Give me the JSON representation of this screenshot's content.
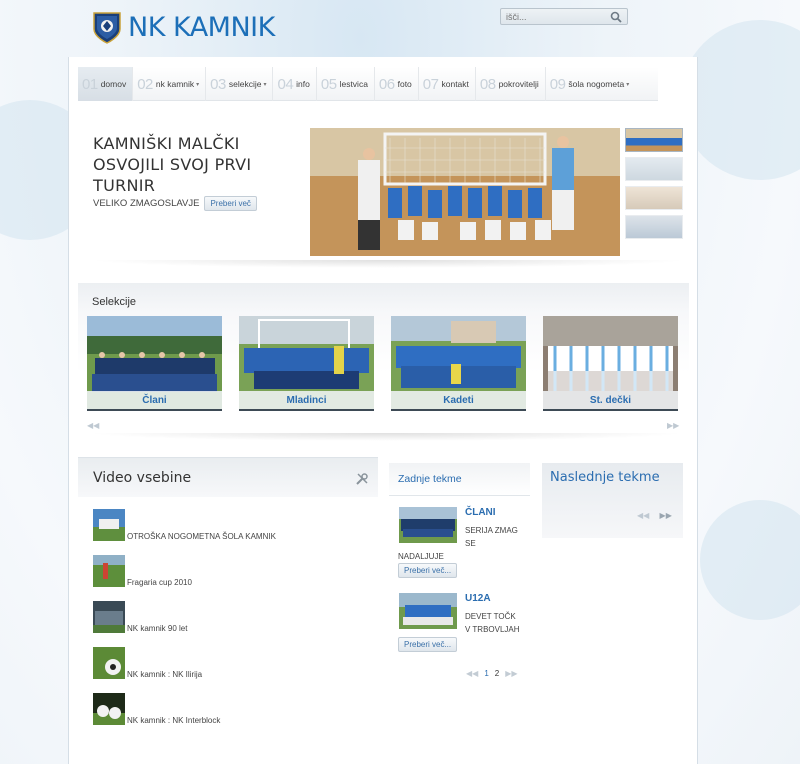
{
  "header": {
    "logo_text": "NK KAMNIK",
    "search_placeholder": "išči..."
  },
  "nav": {
    "items": [
      {
        "num": "01",
        "label": "domov",
        "caret": false
      },
      {
        "num": "02",
        "label": "nk kamnik",
        "caret": true
      },
      {
        "num": "03",
        "label": "selekcije",
        "caret": true
      },
      {
        "num": "04",
        "label": "info",
        "caret": false
      },
      {
        "num": "05",
        "label": "lestvica",
        "caret": false
      },
      {
        "num": "06",
        "label": "foto",
        "caret": false
      },
      {
        "num": "07",
        "label": "kontakt",
        "caret": false
      },
      {
        "num": "08",
        "label": "pokrovitelji",
        "caret": false
      },
      {
        "num": "09",
        "label": "šola nogometa",
        "caret": true
      }
    ],
    "caret_glyph": "▾"
  },
  "feature": {
    "title": "KAMNIŠKI MALČKI OSVOJILI SVOJ PRVI TURNIR",
    "subtitle": "VELIKO ZMAGOSLAVJE",
    "read_more": "Preberi več"
  },
  "selekcije": {
    "title": "Selekcije",
    "items": [
      {
        "label": "Člani"
      },
      {
        "label": "Mladinci"
      },
      {
        "label": "Kadeti"
      },
      {
        "label": "St. dečki"
      }
    ],
    "prev": "◀◀",
    "next": "▶▶"
  },
  "video": {
    "title": "Video vsebine",
    "items": [
      {
        "label": "OTROŠKA NOGOMETNA ŠOLA KAMNIK"
      },
      {
        "label": "Fragaria cup 2010"
      },
      {
        "label": "NK kamnik 90 let"
      },
      {
        "label": "NK kamnik : NK Ilirija"
      },
      {
        "label": "NK kamnik : NK Interblock"
      }
    ]
  },
  "last_matches": {
    "title": "Zadnje tekme",
    "items": [
      {
        "team": "ČLANI",
        "text_lines": [
          "SERIJA ZMAG",
          "SE"
        ],
        "text_continue": "NADALJUJE",
        "read_more": "Preberi več..."
      },
      {
        "team": "U12A",
        "text_lines": [
          "DEVET TOČK",
          "V TRBOVLJAH"
        ],
        "text_continue": "",
        "read_more": "Preberi več..."
      }
    ],
    "pager": {
      "prev": "◀◀",
      "pages": [
        "1",
        "2"
      ],
      "next": "▶▶"
    }
  },
  "next_matches": {
    "title": "Naslednje tekme",
    "prev": "◀◀",
    "next": "▶▶"
  },
  "colors": {
    "brand_blue": "#1c6fb8",
    "link_blue": "#2b6db0"
  }
}
